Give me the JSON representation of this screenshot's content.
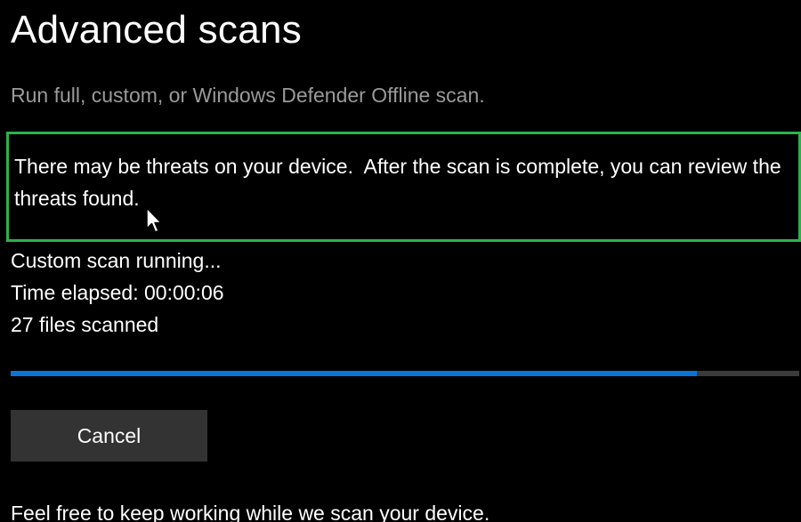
{
  "header": {
    "title": "Advanced scans",
    "subtitle": "Run full, custom, or Windows Defender Offline scan."
  },
  "notice": {
    "text": "There may be threats on your device.  After the scan is complete, you can review the threats found.",
    "border_color": "#2bb24c"
  },
  "scan": {
    "status": "Custom scan running...",
    "time_elapsed": "Time elapsed: 00:00:06",
    "files_scanned": "27  files scanned",
    "progress_fraction": 0.87,
    "progress_color": "#0a74d8",
    "track_color": "#3b3b3b"
  },
  "actions": {
    "cancel_label": "Cancel"
  },
  "footer": {
    "text": "Feel free to keep working while we scan your device."
  },
  "icons": {
    "pointer": "mouse-pointer-icon"
  }
}
